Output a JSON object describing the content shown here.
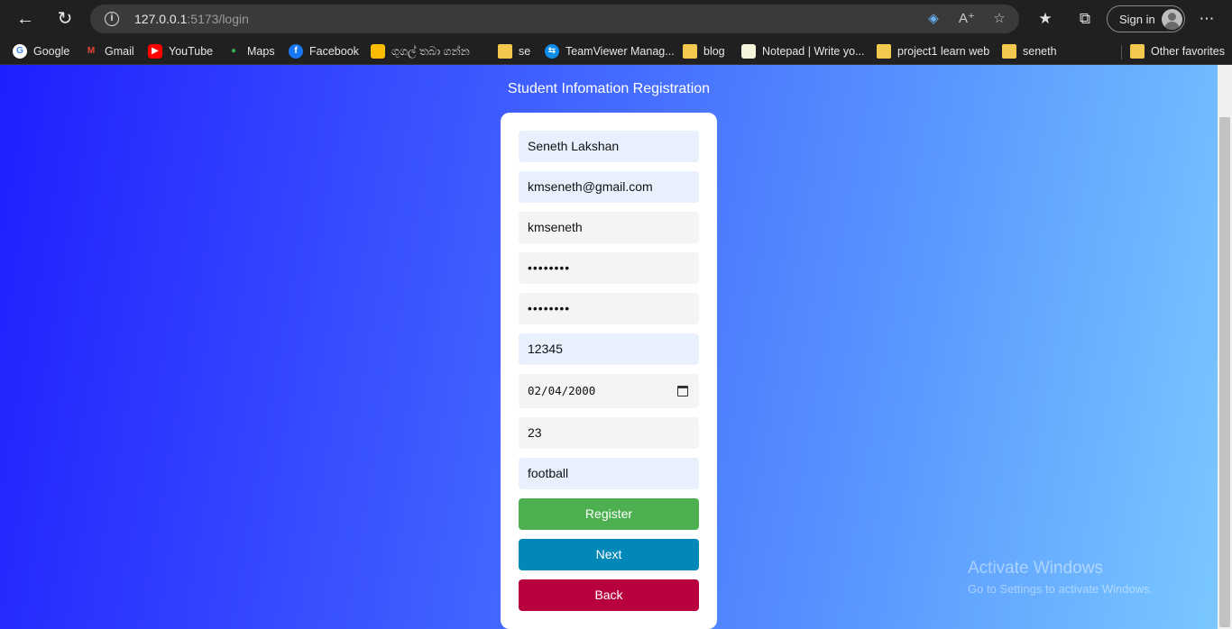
{
  "browser": {
    "url_host": "127.0.0.1",
    "url_path": ":5173/login",
    "signin_label": "Sign in",
    "icons": {
      "back": "arrow-left-icon",
      "refresh": "refresh-icon",
      "info": "info-icon",
      "coupon": "tag-icon",
      "read_aloud": "read-aloud-icon",
      "add_favorite": "star-plus-icon",
      "favorites": "favorites-icon",
      "collections": "collections-icon",
      "more": "more-icon"
    }
  },
  "bookmarks": [
    {
      "label": "Google",
      "icon": "google-icon"
    },
    {
      "label": "Gmail",
      "icon": "gmail-icon"
    },
    {
      "label": "YouTube",
      "icon": "youtube-icon"
    },
    {
      "label": "Maps",
      "icon": "maps-icon"
    },
    {
      "label": "Facebook",
      "icon": "facebook-icon"
    },
    {
      "label": "ගුගල් තබා ගන්න",
      "icon": "keep-icon"
    },
    {
      "label": "se",
      "icon": "folder-icon"
    },
    {
      "label": "TeamViewer Manag...",
      "icon": "teamviewer-icon"
    },
    {
      "label": "blog",
      "icon": "folder-icon"
    },
    {
      "label": "Notepad | Write yo...",
      "icon": "notepad-icon"
    },
    {
      "label": "project1 learn web",
      "icon": "folder-icon"
    },
    {
      "label": "seneth",
      "icon": "folder-icon"
    },
    {
      "label": "Other favorites",
      "icon": "folder-icon"
    }
  ],
  "page": {
    "title": "Student Infomation Registration",
    "fields": {
      "name": "Seneth Lakshan",
      "email": "kmseneth@gmail.com",
      "username": "kmseneth",
      "password": "••••••••",
      "confirm_password": "••••••••",
      "id": "12345",
      "dob": "02/04/2000",
      "age": "23",
      "hobby": "football"
    },
    "buttons": {
      "register": "Register",
      "next": "Next",
      "back": "Back"
    },
    "colors": {
      "register": "#4caf50",
      "next": "#0288b8",
      "back": "#b8003c"
    }
  },
  "watermark": {
    "line1": "Activate Windows",
    "line2": "Go to Settings to activate Windows."
  }
}
